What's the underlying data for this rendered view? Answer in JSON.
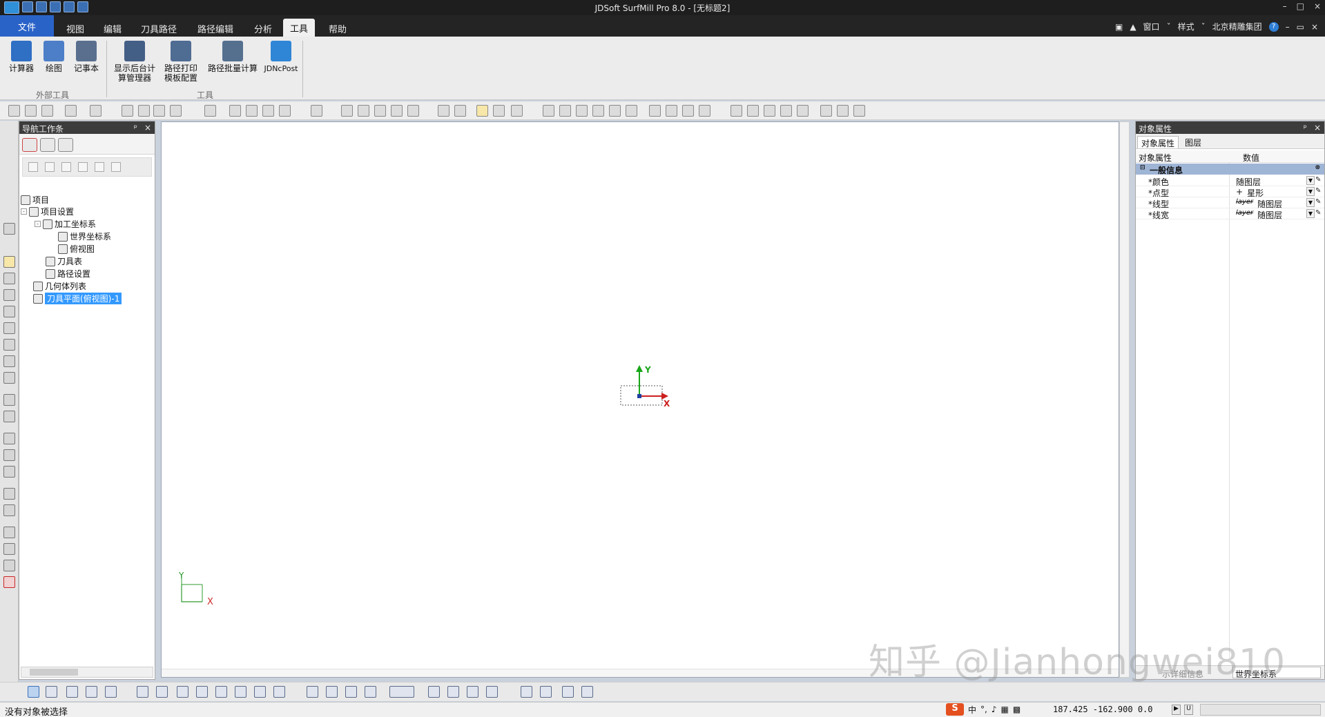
{
  "window": {
    "title": "JDSoft SurfMill Pro 8.0 - [无标题2]",
    "controls": [
      "–",
      "□",
      "×"
    ]
  },
  "menu": {
    "file": "文件",
    "items": [
      "视图",
      "编辑",
      "刀具路径",
      "路径编辑",
      "分析",
      "工具",
      "帮助"
    ],
    "active_index": 5,
    "right": {
      "window": "窗口",
      "style": "样式",
      "company": "北京精雕集团",
      "help": "?"
    }
  },
  "ribbon": {
    "buttons": [
      {
        "label": "计算器"
      },
      {
        "label": "绘图"
      },
      {
        "label": "记事本"
      },
      {
        "label_line1": "显示后台计",
        "label_line2": "算管理器"
      },
      {
        "label_line1": "路径打印",
        "label_line2": "模板配置"
      },
      {
        "label": "路径批量计算"
      },
      {
        "label": "JDNcPost"
      }
    ],
    "groups": {
      "external": "外部工具",
      "tools": "工具"
    }
  },
  "nav_panel": {
    "title": "导航工作条",
    "pin": "ᵖ",
    "close": "×",
    "tree": [
      {
        "label": "项目",
        "level": 0,
        "toggle": ""
      },
      {
        "label": "项目设置",
        "level": 0,
        "toggle": "-"
      },
      {
        "label": "加工坐标系",
        "level": 1,
        "toggle": "-"
      },
      {
        "label": "世界坐标系",
        "level": 2,
        "toggle": ""
      },
      {
        "label": "俯视图",
        "level": 2,
        "toggle": ""
      },
      {
        "label": "刀具表",
        "level": 1,
        "toggle": ""
      },
      {
        "label": "路径设置",
        "level": 1,
        "toggle": ""
      },
      {
        "label": "几何体列表",
        "level": 0,
        "toggle": ""
      },
      {
        "label": "刀具平面(俯视图)-1",
        "level": 0,
        "toggle": "",
        "selected": true
      }
    ]
  },
  "viewport": {
    "axis_main": {
      "x": "X",
      "y": "Y"
    },
    "axis_corner": {
      "x": "X",
      "y": "Y"
    },
    "colors": {
      "x_axis": "#cc1f1f",
      "y_axis": "#19a619",
      "corner_axis": "#2f9b2f"
    }
  },
  "props_panel": {
    "title": "对象属性",
    "pin": "ᵖ",
    "close": "×",
    "tabs": [
      "对象属性",
      "图层"
    ],
    "active_tab": 0,
    "columns": {
      "name": "对象属性",
      "value": "数值"
    },
    "category": "一般信息",
    "rows": [
      {
        "name": "*颜色",
        "value": "随图层",
        "prefix": ""
      },
      {
        "name": "*点型",
        "value": "星形",
        "prefix": "+"
      },
      {
        "name": "*线型",
        "value": "随图层",
        "prefix": "layer"
      },
      {
        "name": "*线宽",
        "value": "随图层",
        "prefix": "layer"
      }
    ],
    "footer_left": "示详细信息",
    "footer_right": "世界坐标系"
  },
  "statusbar": {
    "message": "没有对象被选择",
    "ime": "中",
    "coords": "187.425 -162.900 0.0"
  },
  "watermark": "知乎 @Jianhongwei810"
}
